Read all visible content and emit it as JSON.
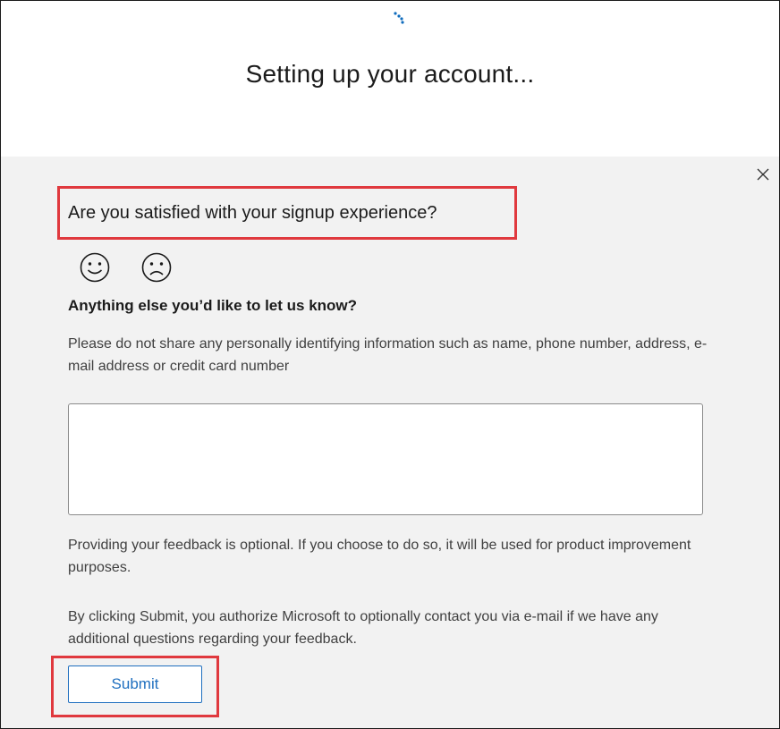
{
  "header": {
    "title": "Setting up your account..."
  },
  "feedback": {
    "question": "Are you satisfied with your signup experience?",
    "options": [
      {
        "icon": "happy-face-icon",
        "meaning": "satisfied"
      },
      {
        "icon": "sad-face-icon",
        "meaning": "not satisfied"
      }
    ],
    "comment_question": "Anything else you’d like to let us know?",
    "privacy_notice": "Please do not share any personally identifying information such as name, phone number, address, e-mail address or credit card number",
    "comment_value": "",
    "optional_notice": "Providing your feedback is optional. If you choose to do so, it will be used for product improvement purposes.",
    "consent_notice": "By clicking Submit, you authorize Microsoft to optionally contact you via e-mail if we have any additional questions regarding your feedback.",
    "submit_label": "Submit",
    "close_icon": "close-icon"
  },
  "colors": {
    "accent": "#1f6fbf",
    "highlight": "#e0393e",
    "panel_bg": "#f2f2f2"
  }
}
